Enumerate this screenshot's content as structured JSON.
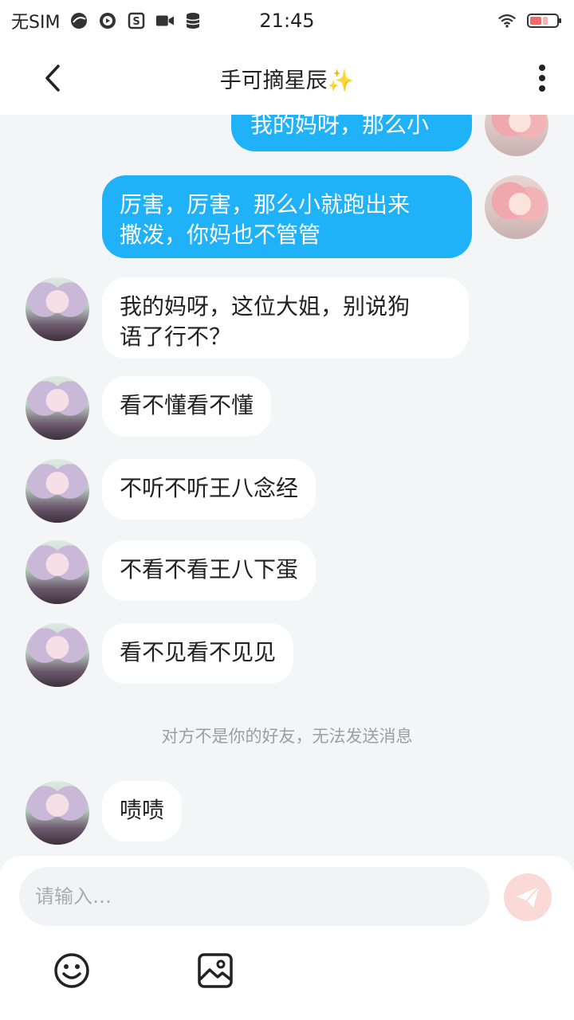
{
  "status_bar": {
    "carrier": "无SIM",
    "time": "21:45",
    "icons": [
      "browser-icon",
      "play-icon",
      "s-app-icon",
      "video-icon",
      "storage-icon",
      "wifi-icon",
      "battery-icon"
    ]
  },
  "header": {
    "title": "手可摘星辰✨"
  },
  "messages": [
    {
      "side": "right",
      "text": "我的妈呀，那么小"
    },
    {
      "side": "right",
      "line1": "厉害，厉害，那么小就跑出来",
      "line2": "撒泼，你妈也不管管"
    },
    {
      "side": "left",
      "line1": "我的妈呀，这位大姐，别说狗",
      "line2": "语了行不？"
    },
    {
      "side": "left",
      "text": "看不懂看不懂"
    },
    {
      "side": "left",
      "text": "不听不听王八念经"
    },
    {
      "side": "left",
      "text": "不看不看王八下蛋"
    },
    {
      "side": "left",
      "text": "看不见看不见见"
    },
    {
      "side": "left",
      "text": "啧啧"
    }
  ],
  "system_note": "对方不是你的好友，无法发送消息",
  "composer": {
    "placeholder": "请输入…",
    "tools": [
      "smiley-icon",
      "image-icon"
    ]
  },
  "colors": {
    "outgoing_bubble": "#1fb2f8",
    "incoming_bubble": "#ffffff",
    "background": "#f4f5f7",
    "send_button": "#fbd9d6"
  }
}
